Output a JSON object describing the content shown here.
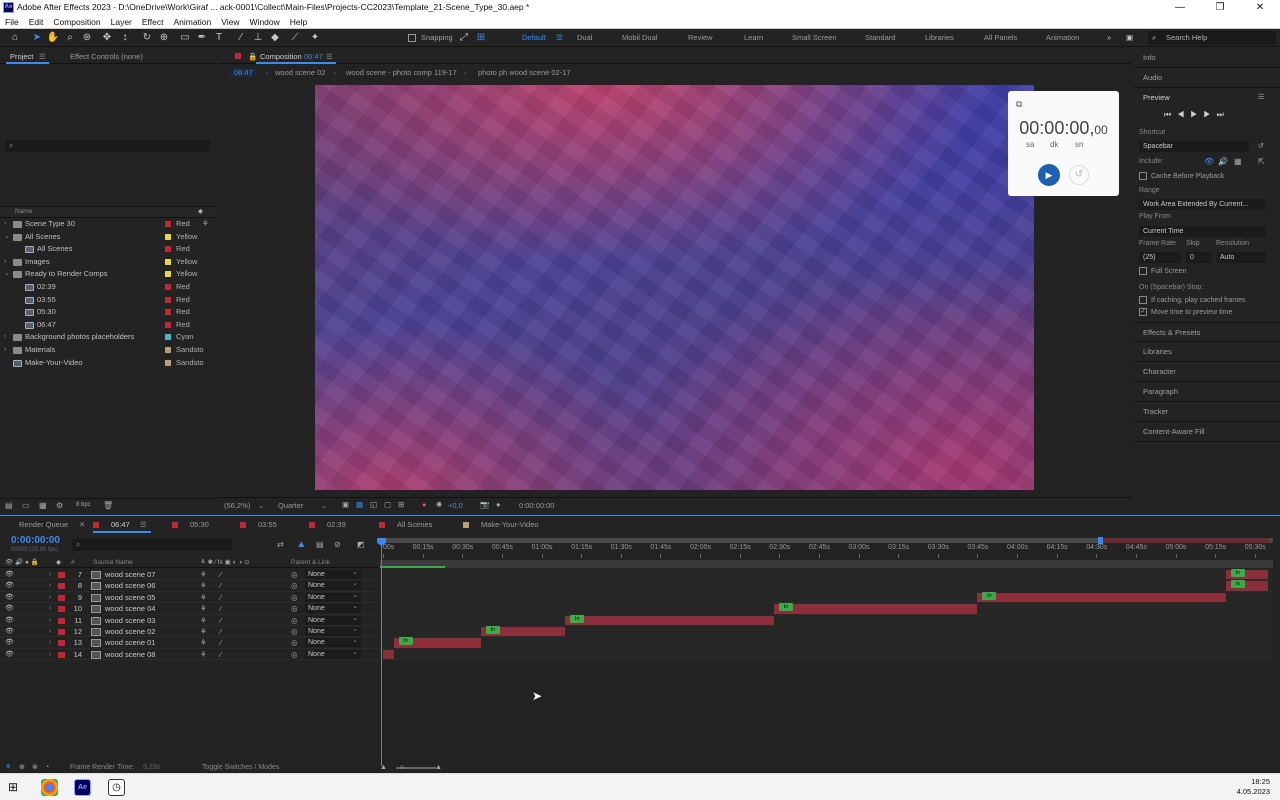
{
  "window": {
    "title": "Adobe After Effects 2023 - D:\\OneDrive\\Work\\Giraf ... ack-0001\\Collect\\Main-Files\\Projects-CC2023\\Template_21-Scene_Type_30.aep *",
    "logo": "Ae",
    "controls": [
      "—",
      "❐",
      "✕"
    ]
  },
  "menu": [
    "File",
    "Edit",
    "Composition",
    "Layer",
    "Effect",
    "Animation",
    "View",
    "Window",
    "Help"
  ],
  "toolbar": {
    "snapping_label": "Snapping",
    "workspaces": [
      "Default",
      "Dual",
      "Mobil Dual",
      "Review",
      "Learn",
      "Small Screen",
      "Standard",
      "Libraries",
      "All Panels",
      "Animation"
    ],
    "active_workspace": "Default",
    "search_placeholder": "Search Help"
  },
  "project_panel": {
    "tab_project": "Project",
    "tab_effect_controls": "Effect Controls (none)",
    "search_placeholder": "⌕",
    "col_name": "Name",
    "items": [
      {
        "name": "Scene Type 30",
        "type": "folder",
        "indent": 0,
        "label": "Red",
        "color": "#c0283a",
        "open": false
      },
      {
        "name": "All Scenes",
        "type": "folder",
        "indent": 0,
        "label": "Yellow",
        "color": "#e6d64a",
        "open": true
      },
      {
        "name": "All Scenes",
        "type": "comp",
        "indent": 1,
        "label": "Red",
        "color": "#c0283a",
        "open": false
      },
      {
        "name": "Images",
        "type": "folder",
        "indent": 0,
        "label": "Yellow",
        "color": "#e6d64a",
        "open": false
      },
      {
        "name": "Ready to Render Comps",
        "type": "folder",
        "indent": 0,
        "label": "Yellow",
        "color": "#e6d64a",
        "open": true
      },
      {
        "name": "02:39",
        "type": "comp",
        "indent": 1,
        "label": "Red",
        "color": "#c0283a",
        "open": false
      },
      {
        "name": "03:55",
        "type": "comp",
        "indent": 1,
        "label": "Red",
        "color": "#c0283a",
        "open": false
      },
      {
        "name": "05:30",
        "type": "comp",
        "indent": 1,
        "label": "Red",
        "color": "#c0283a",
        "open": false
      },
      {
        "name": "06:47",
        "type": "comp",
        "indent": 1,
        "label": "Red",
        "color": "#c0283a",
        "open": false
      },
      {
        "name": "Background photos placeholders",
        "type": "folder",
        "indent": 0,
        "label": "Cyan",
        "color": "#49b7c0",
        "open": false
      },
      {
        "name": "Materials",
        "type": "folder",
        "indent": 0,
        "label": "Sandsto",
        "color": "#b89e7a",
        "open": false
      },
      {
        "name": "Make-Your-Video",
        "type": "comp",
        "indent": 0,
        "label": "Sandsto",
        "color": "#b89e7a",
        "open": false
      }
    ],
    "bpc": "8 bpc"
  },
  "composition_panel": {
    "tab_label": "Composition",
    "tab_comp": "06:47",
    "breadcrumbs": [
      "06:47",
      "wood scene 02",
      "wood scene - photo comp 119-17",
      "photo ph wood scene 02-17"
    ],
    "zoom": "(56,2%)",
    "resolution": "Quarter",
    "exposure": "+0,0",
    "timecode": "0:00:00:00"
  },
  "timer_widget": {
    "time_main": "00:00:00,",
    "time_small": "00",
    "units": [
      "sa",
      "dk",
      "sn"
    ]
  },
  "right_panel": {
    "info": "Info",
    "audio": "Audio",
    "preview": "Preview",
    "shortcut_label": "Shortcut",
    "shortcut_value": "Spacebar",
    "include_label": "Include:",
    "cache_before": "Cache Before Playback",
    "range_label": "Range",
    "range_value": "Work Area Extended By Current...",
    "play_from_label": "Play From",
    "play_from_value": "Current Time",
    "frame_rate_label": "Frame Rate",
    "skip_label": "Skip",
    "resolution_label": "Resolution",
    "frame_rate_value": "(25)",
    "skip_value": "0",
    "resolution_value": "Auto",
    "full_screen": "Full Screen",
    "on_stop_label": "On (Spacebar) Stop:",
    "if_caching": "If caching, play cached frames",
    "move_time": "Move time to preview time",
    "sections": [
      "Effects & Presets",
      "Libraries",
      "Character",
      "Paragraph",
      "Tracker",
      "Content-Aware Fill"
    ]
  },
  "timeline": {
    "tabs": [
      {
        "label": "Render Queue",
        "color": ""
      },
      {
        "label": "06:47",
        "color": "#c0283a",
        "active": true
      },
      {
        "label": "05:30",
        "color": "#c0283a"
      },
      {
        "label": "03:55",
        "color": "#c0283a"
      },
      {
        "label": "02:39",
        "color": "#c0283a"
      },
      {
        "label": "All Scenes",
        "color": "#c0283a"
      },
      {
        "label": "Make-Your-Video",
        "color": "#b89e7a"
      }
    ],
    "timecode": "0:00:00:00",
    "fps": "00000 (25.00 fps)",
    "col_hash": "#",
    "col_source": "Source Name",
    "col_parent": "Parent & Link",
    "ruler": [
      "00s",
      "00:15s",
      "00:30s",
      "00:45s",
      "01:00s",
      "01:15s",
      "01:30s",
      "01:45s",
      "02:00s",
      "02:15s",
      "02:30s",
      "02:45s",
      "03:00s",
      "03:15s",
      "03:30s",
      "03:45s",
      "04:00s",
      "04:15s",
      "04:30s",
      "04:45s",
      "05:00s",
      "05:15s",
      "05:30s"
    ],
    "duration_s": 335,
    "layers": [
      {
        "num": "7",
        "name": "wood scene 07",
        "parent": "None",
        "in_s": 319,
        "out_s": 335
      },
      {
        "num": "8",
        "name": "wood scene 06",
        "parent": "None",
        "in_s": 319,
        "out_s": 335
      },
      {
        "num": "9",
        "name": "wood scene 05",
        "parent": "None",
        "in_s": 225,
        "out_s": 319
      },
      {
        "num": "10",
        "name": "wood scene 04",
        "parent": "None",
        "in_s": 148,
        "out_s": 225
      },
      {
        "num": "11",
        "name": "wood scene 03",
        "parent": "None",
        "in_s": 69,
        "out_s": 148
      },
      {
        "num": "12",
        "name": "wood scene 02",
        "parent": "None",
        "in_s": 37,
        "out_s": 69
      },
      {
        "num": "13",
        "name": "wood scene 01",
        "parent": "None",
        "in_s": 4,
        "out_s": 37
      },
      {
        "num": "14",
        "name": "wood scene 08",
        "parent": "None",
        "in_s": 0,
        "out_s": 4
      }
    ],
    "in_badge": "In",
    "frame_render_label": "Frame Render Time:",
    "frame_render_value": "9,23s",
    "toggle_label": "Toggle Switches / Modes"
  },
  "taskbar": {
    "time": "18:25",
    "date": "4.05.2023"
  }
}
